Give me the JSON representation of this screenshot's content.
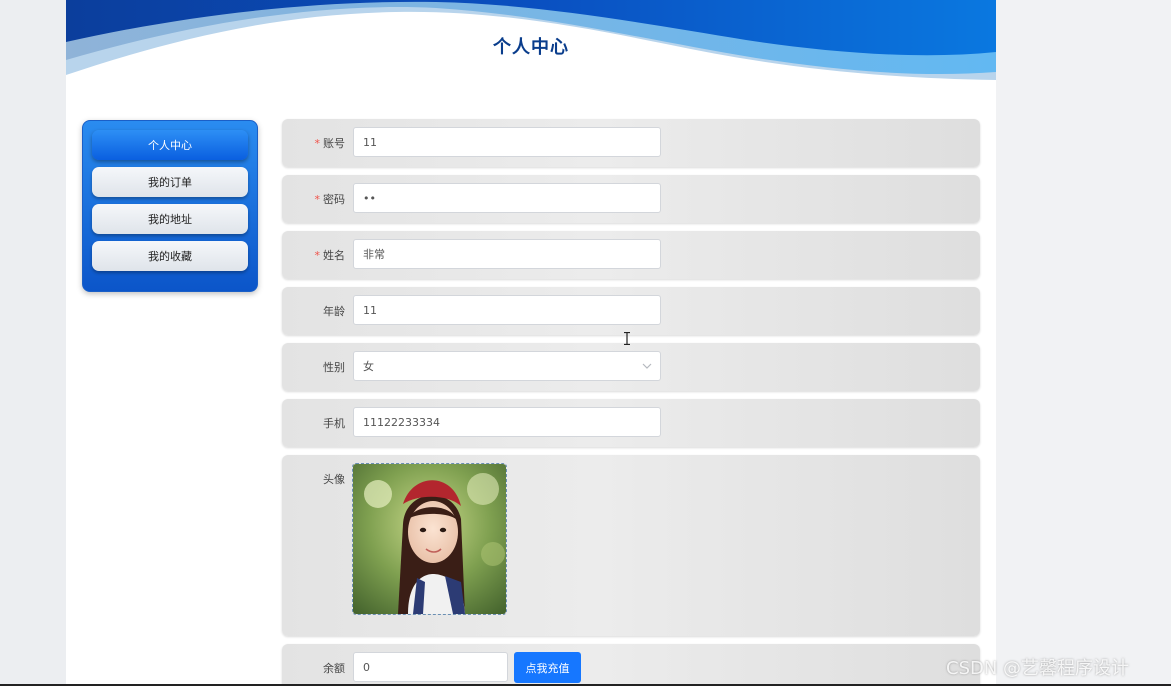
{
  "header": {
    "title": "个人中心"
  },
  "sidebar": {
    "items": [
      {
        "label": "个人中心",
        "active": true
      },
      {
        "label": "我的订单",
        "active": false
      },
      {
        "label": "我的地址",
        "active": false
      },
      {
        "label": "我的收藏",
        "active": false
      }
    ]
  },
  "form": {
    "account": {
      "label": "账号",
      "required": "*",
      "value": "11"
    },
    "password": {
      "label": "密码",
      "required": "*",
      "value": "••"
    },
    "name": {
      "label": "姓名",
      "required": "*",
      "value": "非常"
    },
    "age": {
      "label": "年龄",
      "value": "11"
    },
    "gender": {
      "label": "性别",
      "value": "女"
    },
    "phone": {
      "label": "手机",
      "value": "11122233334"
    },
    "avatar": {
      "label": "头像"
    },
    "balance": {
      "label": "余额",
      "value": "0",
      "button": "点我充值"
    }
  },
  "watermark": "CSDN @艺馨程序设计",
  "colors": {
    "primary": "#1677ff",
    "title": "#0a3d8c",
    "required": "#f0524a",
    "banner_dark": "#0a4fb8",
    "banner_light": "#5fb4f0"
  }
}
